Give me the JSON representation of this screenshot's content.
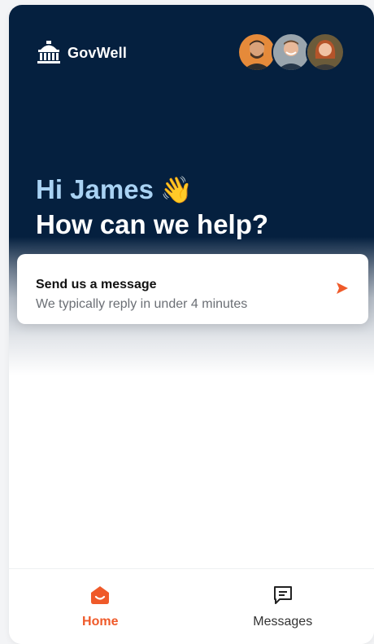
{
  "brand": {
    "name": "GovWell",
    "icon": "capitol-building-icon"
  },
  "avatars": [
    {
      "name": "team-member-1"
    },
    {
      "name": "team-member-2"
    },
    {
      "name": "team-member-3"
    }
  ],
  "greeting": {
    "hello": "Hi James",
    "emoji": "👋",
    "question": "How can we help?"
  },
  "message_card": {
    "title": "Send us a message",
    "subtitle": "We typically reply in under 4 minutes",
    "icon": "send-arrow-icon"
  },
  "nav": {
    "home_label": "Home",
    "messages_label": "Messages",
    "active": "Home"
  },
  "colors": {
    "hero_bg": "#05203f",
    "accent": "#ef5a2a",
    "greeting_text": "#a9d2f3"
  }
}
